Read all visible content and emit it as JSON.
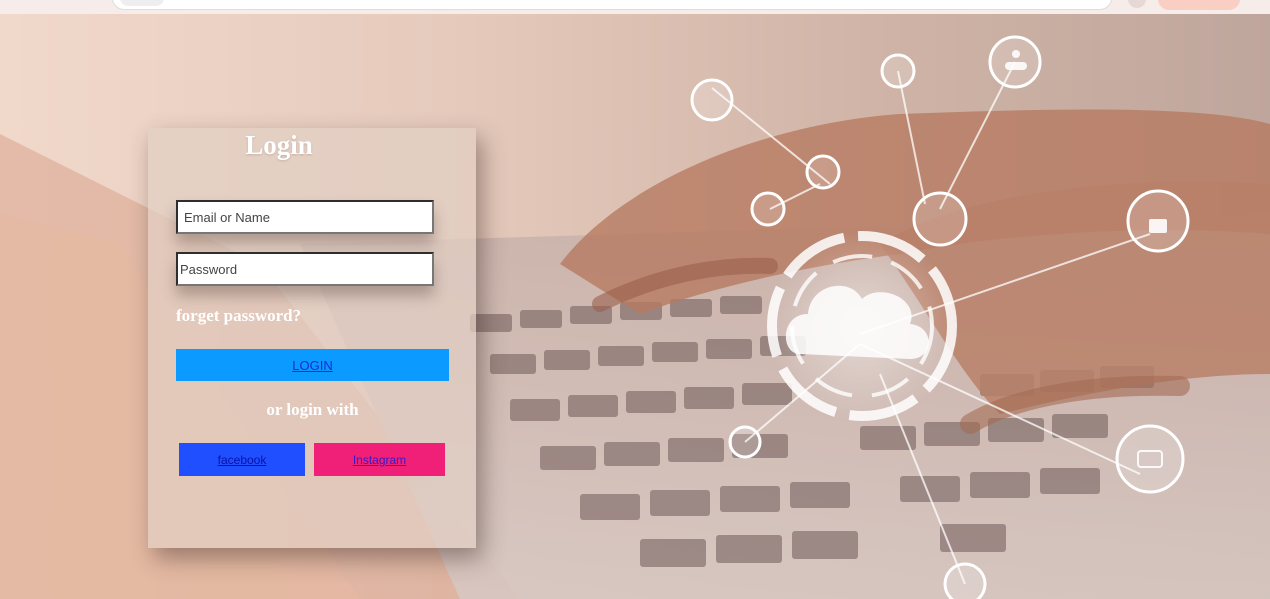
{
  "login": {
    "title": "Login",
    "email_placeholder": "Email or Name",
    "password_placeholder": "Password",
    "forget_password": "forget password?",
    "login_button": "LOGIN",
    "or_login_with": "or login with",
    "facebook": "facebook",
    "instagram": "Instagram"
  },
  "colors": {
    "login_button": "#0b9aff",
    "facebook_button": "#1f4fff",
    "instagram_button": "#f01f78"
  }
}
